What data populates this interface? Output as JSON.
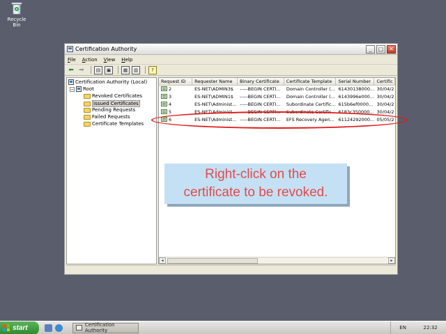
{
  "desktop": {
    "recycle_bin_label": "Recycle Bin"
  },
  "window": {
    "title": "Certification Authority",
    "buttons": {
      "minimize": "_",
      "maximize": "□",
      "close": "✕"
    }
  },
  "menu": {
    "file": {
      "first": "F",
      "rest": "ile"
    },
    "action": {
      "first": "A",
      "rest": "ction"
    },
    "view": {
      "first": "V",
      "rest": "iew"
    },
    "help": {
      "first": "H",
      "rest": "elp"
    }
  },
  "tree": {
    "root_label": "Certification Authority (Local)",
    "ca_label": "Root",
    "items": [
      "Revoked Certificates",
      "Issued Certificates",
      "Pending Requests",
      "Failed Requests",
      "Certificate Templates"
    ],
    "selected": "Issued Certificates"
  },
  "list": {
    "columns": [
      "Request ID",
      "Requester Name",
      "Binary Certificate",
      "Certificate Template",
      "Serial Number",
      "Certific"
    ],
    "rows": [
      [
        "2",
        "ES-NET\\ADMIN3$",
        "-----BEGIN CERTI...",
        "Domain Controller (...",
        "61430138000...",
        "30/04/2"
      ],
      [
        "3",
        "ES-NET\\ADMIN1$",
        "-----BEGIN CERTI...",
        "Domain Controller (...",
        "6143996e000...",
        "30/04/2"
      ],
      [
        "4",
        "ES-NET\\Administ...",
        "-----BEGIN CERTI...",
        "Subordinate Certific...",
        "615b6ef0000...",
        "30/04/2"
      ],
      [
        "5",
        "ES-NET\\Administ...",
        "-----BEGIN CERTI...",
        "Subordinate Certific...",
        "6183c350000...",
        "30/04/2"
      ],
      [
        "6",
        "ES-NET\\Administ...",
        "-----BEGIN CERTI...",
        "EFS Recovery Agen...",
        "61124292000...",
        "05/05/2"
      ]
    ]
  },
  "callout": {
    "line1": "Right-click on the",
    "line2": "certificate to be revoked."
  },
  "taskbar": {
    "start_label": "start",
    "task_label": "Certification Authority",
    "language": "EN",
    "clock": "22:32"
  },
  "colors": {
    "highlight": "#e01a1a",
    "callout_bg": "#c4e0f4",
    "callout_text": "#e24b4b"
  }
}
